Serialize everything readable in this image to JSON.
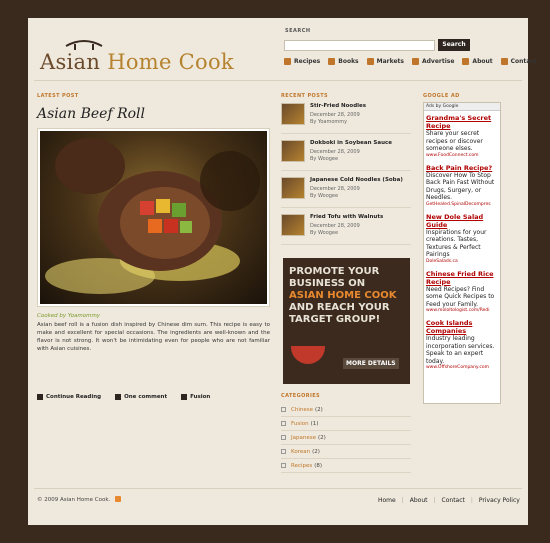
{
  "logo": {
    "asian": "Asian",
    "home_cook": "Home Cook"
  },
  "search": {
    "label": "SEARCH",
    "button": "Search",
    "placeholder": ""
  },
  "nav": [
    {
      "label": "Recipes",
      "icon": "bowl-icon"
    },
    {
      "label": "Books",
      "icon": "book-icon"
    },
    {
      "label": "Markets",
      "icon": "market-icon"
    },
    {
      "label": "Advertise",
      "icon": "megaphone-icon"
    },
    {
      "label": "About",
      "icon": "info-icon"
    },
    {
      "label": "Contact",
      "icon": "mail-icon"
    }
  ],
  "latest": {
    "label": "LATEST POST",
    "title": "Asian Beef Roll",
    "cooked_by": "Cooked by Yoamommy",
    "excerpt": "Asian beef roll is a fusion dish inspired by Chinese dim sum. This recipe is easy to make and excellent for special occasions. The ingredients are well-known and the flavor is not strong. It won't be intimidating even for people who are not familiar with Asian cuisines.",
    "meta": [
      {
        "label": "Continue Reading",
        "icon": "arrow-icon"
      },
      {
        "label": "One comment",
        "icon": "comment-icon"
      },
      {
        "label": "Fusion",
        "icon": "tag-icon"
      }
    ]
  },
  "recent": {
    "label": "RECENT POSTS",
    "items": [
      {
        "title": "Stir-Fried Noodles",
        "date": "December 28, 2009",
        "by": "By Yoamommy"
      },
      {
        "title": "Dokboki in Soybean Sauce",
        "date": "December 28, 2009",
        "by": "By Woogee"
      },
      {
        "title": "Japanese Cold Noodles (Soba)",
        "date": "December 28, 2009",
        "by": "By Woogee"
      },
      {
        "title": "Fried Tofu with Walnuts",
        "date": "December 28, 2009",
        "by": "By Woogee"
      }
    ]
  },
  "promo": {
    "line1": "PROMOTE YOUR",
    "line2": "BUSINESS ON",
    "line3": "ASIAN HOME COOK",
    "line4": "AND REACH YOUR",
    "line5": "TARGET GROUP!",
    "more": "MORE DETAILS"
  },
  "categories": {
    "label": "CATEGORIES",
    "items": [
      {
        "name": "Chinese",
        "count": "(2)"
      },
      {
        "name": "Fusion",
        "count": "(1)"
      },
      {
        "name": "Japanese",
        "count": "(2)"
      },
      {
        "name": "Korean",
        "count": "(2)"
      },
      {
        "name": "Recipes",
        "count": "(8)"
      }
    ]
  },
  "google_ad": {
    "label": "GOOGLE AD",
    "ads_by": "Ads by Google",
    "ads": [
      {
        "title": "Grandma's Secret Recipe",
        "body": "Share your secret recipes or discover someone elses.",
        "url": "www.FoodConnect.com"
      },
      {
        "title": "Back Pain Recipe?",
        "body": "Discover How To Stop Back Pain Fast Without Drugs, Surgery, or Needles.",
        "url": "GetHealed.SpinalDecompres"
      },
      {
        "title": "New Dole Salad Guide",
        "body": "Inspirations for your creations. Tastes, Textures & Perfect Pairings",
        "url": "DoleSalads.ca"
      },
      {
        "title": "Chinese Fried Rice Recipe",
        "body": "Need Recipes? Find some Quick Recipes to Feed your Family.",
        "url": "www.mololtologist.com/Redi"
      },
      {
        "title": "Cook Islands Companies",
        "body": "Industry leading incorporation services. Speak to an expert today.",
        "url": "www.OffshoreCompany.com"
      }
    ]
  },
  "footer": {
    "copyright": "© 2009 Asian Home Cook.",
    "links": [
      "Home",
      "About",
      "Contact",
      "Privacy Policy"
    ]
  }
}
